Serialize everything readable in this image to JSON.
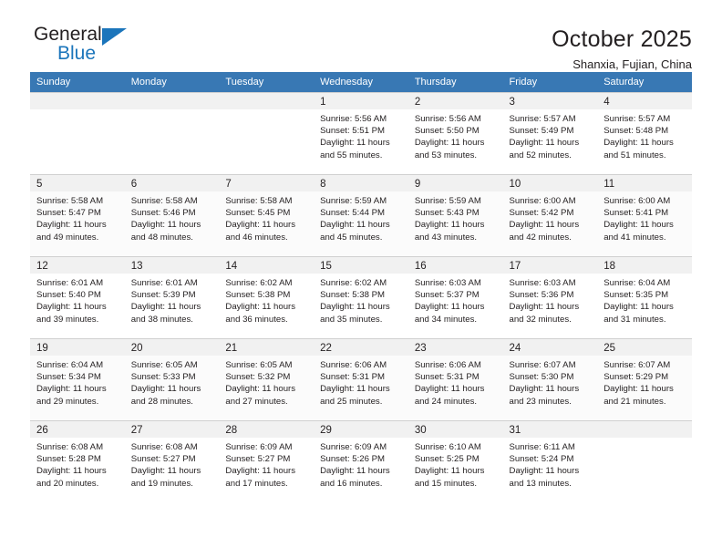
{
  "brand": {
    "name_top": "General",
    "name_bottom": "Blue",
    "accent_color": "#1b75bb"
  },
  "header": {
    "title": "October 2025",
    "location": "Shanxia, Fujian, China"
  },
  "calendar": {
    "header_bg": "#3878b4",
    "weekday_headers": [
      "Sunday",
      "Monday",
      "Tuesday",
      "Wednesday",
      "Thursday",
      "Friday",
      "Saturday"
    ],
    "labels": {
      "sunrise": "Sunrise:",
      "sunset": "Sunset:",
      "daylight": "Daylight:"
    },
    "weeks": [
      [
        {
          "day": "",
          "sunrise": "",
          "sunset": "",
          "daylight": ""
        },
        {
          "day": "",
          "sunrise": "",
          "sunset": "",
          "daylight": ""
        },
        {
          "day": "",
          "sunrise": "",
          "sunset": "",
          "daylight": ""
        },
        {
          "day": "1",
          "sunrise": "Sunrise: 5:56 AM",
          "sunset": "Sunset: 5:51 PM",
          "daylight": "Daylight: 11 hours and 55 minutes."
        },
        {
          "day": "2",
          "sunrise": "Sunrise: 5:56 AM",
          "sunset": "Sunset: 5:50 PM",
          "daylight": "Daylight: 11 hours and 53 minutes."
        },
        {
          "day": "3",
          "sunrise": "Sunrise: 5:57 AM",
          "sunset": "Sunset: 5:49 PM",
          "daylight": "Daylight: 11 hours and 52 minutes."
        },
        {
          "day": "4",
          "sunrise": "Sunrise: 5:57 AM",
          "sunset": "Sunset: 5:48 PM",
          "daylight": "Daylight: 11 hours and 51 minutes."
        }
      ],
      [
        {
          "day": "5",
          "sunrise": "Sunrise: 5:58 AM",
          "sunset": "Sunset: 5:47 PM",
          "daylight": "Daylight: 11 hours and 49 minutes."
        },
        {
          "day": "6",
          "sunrise": "Sunrise: 5:58 AM",
          "sunset": "Sunset: 5:46 PM",
          "daylight": "Daylight: 11 hours and 48 minutes."
        },
        {
          "day": "7",
          "sunrise": "Sunrise: 5:58 AM",
          "sunset": "Sunset: 5:45 PM",
          "daylight": "Daylight: 11 hours and 46 minutes."
        },
        {
          "day": "8",
          "sunrise": "Sunrise: 5:59 AM",
          "sunset": "Sunset: 5:44 PM",
          "daylight": "Daylight: 11 hours and 45 minutes."
        },
        {
          "day": "9",
          "sunrise": "Sunrise: 5:59 AM",
          "sunset": "Sunset: 5:43 PM",
          "daylight": "Daylight: 11 hours and 43 minutes."
        },
        {
          "day": "10",
          "sunrise": "Sunrise: 6:00 AM",
          "sunset": "Sunset: 5:42 PM",
          "daylight": "Daylight: 11 hours and 42 minutes."
        },
        {
          "day": "11",
          "sunrise": "Sunrise: 6:00 AM",
          "sunset": "Sunset: 5:41 PM",
          "daylight": "Daylight: 11 hours and 41 minutes."
        }
      ],
      [
        {
          "day": "12",
          "sunrise": "Sunrise: 6:01 AM",
          "sunset": "Sunset: 5:40 PM",
          "daylight": "Daylight: 11 hours and 39 minutes."
        },
        {
          "day": "13",
          "sunrise": "Sunrise: 6:01 AM",
          "sunset": "Sunset: 5:39 PM",
          "daylight": "Daylight: 11 hours and 38 minutes."
        },
        {
          "day": "14",
          "sunrise": "Sunrise: 6:02 AM",
          "sunset": "Sunset: 5:38 PM",
          "daylight": "Daylight: 11 hours and 36 minutes."
        },
        {
          "day": "15",
          "sunrise": "Sunrise: 6:02 AM",
          "sunset": "Sunset: 5:38 PM",
          "daylight": "Daylight: 11 hours and 35 minutes."
        },
        {
          "day": "16",
          "sunrise": "Sunrise: 6:03 AM",
          "sunset": "Sunset: 5:37 PM",
          "daylight": "Daylight: 11 hours and 34 minutes."
        },
        {
          "day": "17",
          "sunrise": "Sunrise: 6:03 AM",
          "sunset": "Sunset: 5:36 PM",
          "daylight": "Daylight: 11 hours and 32 minutes."
        },
        {
          "day": "18",
          "sunrise": "Sunrise: 6:04 AM",
          "sunset": "Sunset: 5:35 PM",
          "daylight": "Daylight: 11 hours and 31 minutes."
        }
      ],
      [
        {
          "day": "19",
          "sunrise": "Sunrise: 6:04 AM",
          "sunset": "Sunset: 5:34 PM",
          "daylight": "Daylight: 11 hours and 29 minutes."
        },
        {
          "day": "20",
          "sunrise": "Sunrise: 6:05 AM",
          "sunset": "Sunset: 5:33 PM",
          "daylight": "Daylight: 11 hours and 28 minutes."
        },
        {
          "day": "21",
          "sunrise": "Sunrise: 6:05 AM",
          "sunset": "Sunset: 5:32 PM",
          "daylight": "Daylight: 11 hours and 27 minutes."
        },
        {
          "day": "22",
          "sunrise": "Sunrise: 6:06 AM",
          "sunset": "Sunset: 5:31 PM",
          "daylight": "Daylight: 11 hours and 25 minutes."
        },
        {
          "day": "23",
          "sunrise": "Sunrise: 6:06 AM",
          "sunset": "Sunset: 5:31 PM",
          "daylight": "Daylight: 11 hours and 24 minutes."
        },
        {
          "day": "24",
          "sunrise": "Sunrise: 6:07 AM",
          "sunset": "Sunset: 5:30 PM",
          "daylight": "Daylight: 11 hours and 23 minutes."
        },
        {
          "day": "25",
          "sunrise": "Sunrise: 6:07 AM",
          "sunset": "Sunset: 5:29 PM",
          "daylight": "Daylight: 11 hours and 21 minutes."
        }
      ],
      [
        {
          "day": "26",
          "sunrise": "Sunrise: 6:08 AM",
          "sunset": "Sunset: 5:28 PM",
          "daylight": "Daylight: 11 hours and 20 minutes."
        },
        {
          "day": "27",
          "sunrise": "Sunrise: 6:08 AM",
          "sunset": "Sunset: 5:27 PM",
          "daylight": "Daylight: 11 hours and 19 minutes."
        },
        {
          "day": "28",
          "sunrise": "Sunrise: 6:09 AM",
          "sunset": "Sunset: 5:27 PM",
          "daylight": "Daylight: 11 hours and 17 minutes."
        },
        {
          "day": "29",
          "sunrise": "Sunrise: 6:09 AM",
          "sunset": "Sunset: 5:26 PM",
          "daylight": "Daylight: 11 hours and 16 minutes."
        },
        {
          "day": "30",
          "sunrise": "Sunrise: 6:10 AM",
          "sunset": "Sunset: 5:25 PM",
          "daylight": "Daylight: 11 hours and 15 minutes."
        },
        {
          "day": "31",
          "sunrise": "Sunrise: 6:11 AM",
          "sunset": "Sunset: 5:24 PM",
          "daylight": "Daylight: 11 hours and 13 minutes."
        },
        {
          "day": "",
          "sunrise": "",
          "sunset": "",
          "daylight": ""
        }
      ]
    ]
  }
}
